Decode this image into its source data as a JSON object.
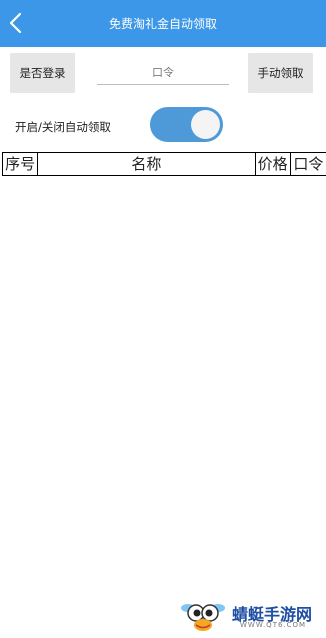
{
  "header": {
    "title": "免费淘礼金自动领取",
    "back_icon": "chevron-left-icon",
    "color": "#3c97e8"
  },
  "controls": {
    "login_label": "是否登录",
    "code_placeholder": "口令",
    "code_value": "",
    "manual_label": "手动领取"
  },
  "auto_toggle": {
    "label": "开启/关闭自动领取",
    "on": true,
    "color": "#4e9ad8"
  },
  "table": {
    "columns": [
      "序号",
      "名称",
      "价格",
      "口令"
    ],
    "rows": []
  },
  "watermark": {
    "text": "蜻蜓手游网",
    "url": "WWW.QT6.COM",
    "logo_icon": "dragonfly-logo-icon"
  }
}
